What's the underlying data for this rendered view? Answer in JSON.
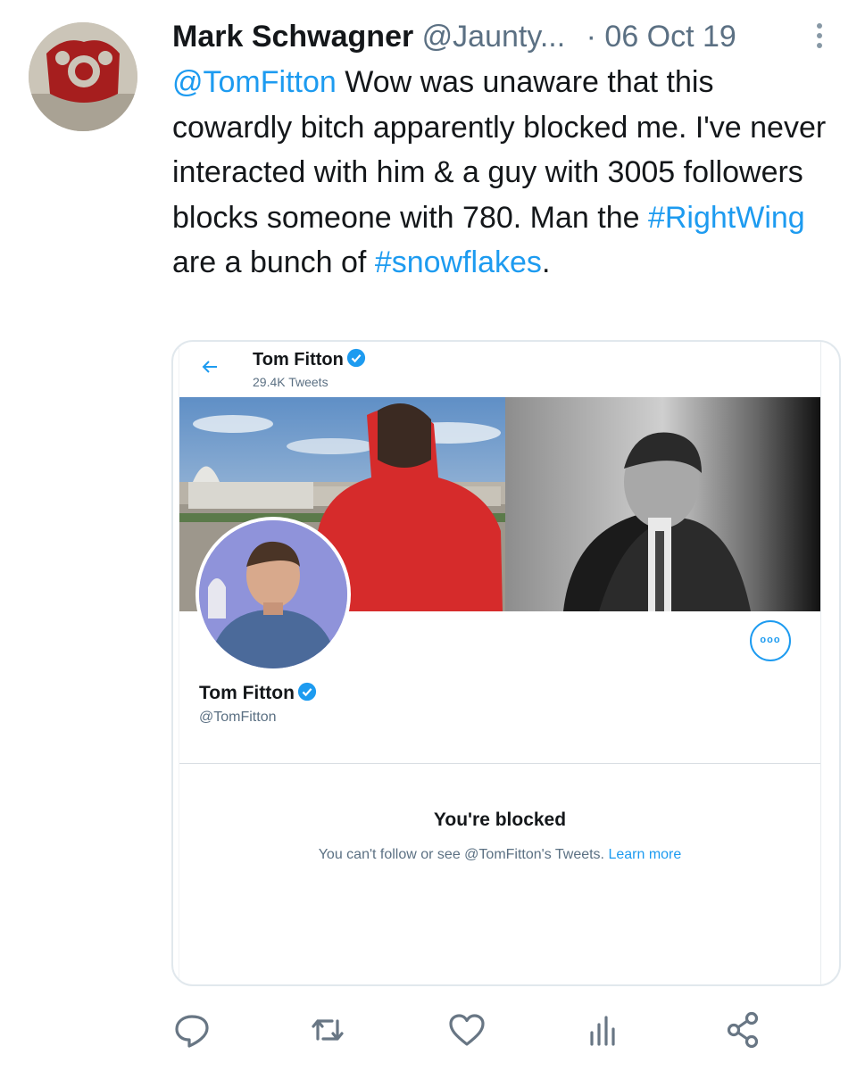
{
  "tweet": {
    "author_name": "Mark Schwagner",
    "author_handle": "@Jaunty...",
    "separator": "·",
    "date": "06 Oct 19",
    "mention": "@TomFitton",
    "text_part1": " Wow was unaware that this cowardly bitch apparently blocked me. I've never interacted with him & a guy with 3005 followers blocks someone with 780. Man the ",
    "hashtag1": "#RightWing",
    "text_part2": " are a bunch of ",
    "hashtag2": "#snowflakes",
    "text_part3": "."
  },
  "embedded_profile": {
    "top_name": "Tom Fitton",
    "tweet_count": "29.4K Tweets",
    "name": "Tom Fitton",
    "handle": "@TomFitton",
    "menu_label": "ooo",
    "blocked_title": "You're blocked",
    "blocked_message": "You can't follow or see @TomFitton's Tweets.",
    "learn_more": "Learn more"
  },
  "icons": {
    "reply": "reply-icon",
    "retweet": "retweet-icon",
    "like": "heart-icon",
    "analytics": "analytics-icon",
    "share": "share-icon"
  },
  "colors": {
    "accent": "#1d9bf0",
    "text": "#14171a",
    "secondary": "#5b7083",
    "action_icon": "#687684"
  }
}
